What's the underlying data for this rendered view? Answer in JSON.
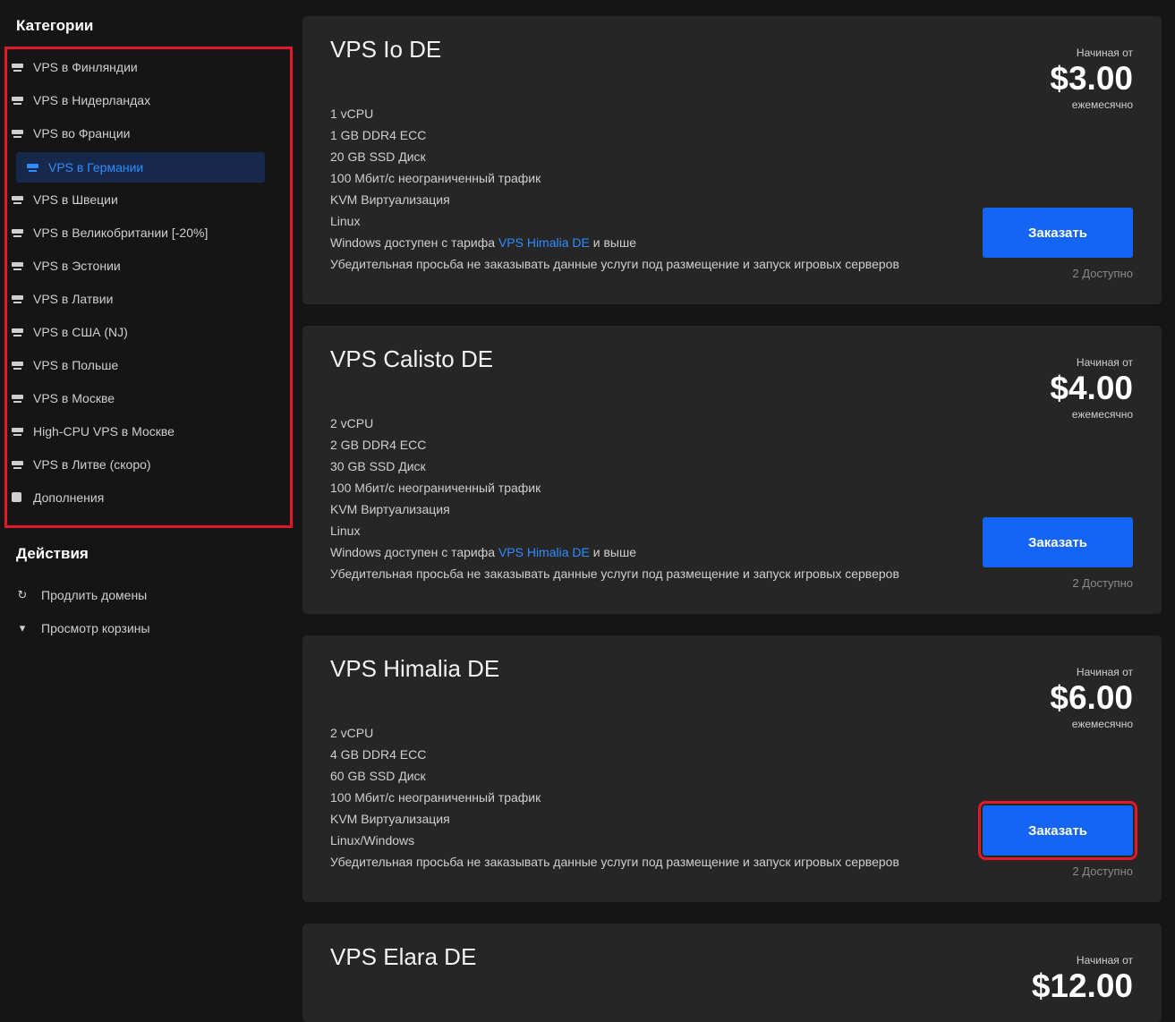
{
  "sidebar": {
    "categories_title": "Категории",
    "categories": [
      {
        "label": "VPS в Финляндии",
        "icon": "server-icon"
      },
      {
        "label": "VPS в Нидерландах",
        "icon": "server-icon"
      },
      {
        "label": "VPS во Франции",
        "icon": "server-icon"
      },
      {
        "label": "VPS в Германии",
        "icon": "server-icon",
        "active": true
      },
      {
        "label": "VPS в Швеции",
        "icon": "server-icon"
      },
      {
        "label": "VPS в Великобритании [-20%]",
        "icon": "server-icon"
      },
      {
        "label": "VPS в Эстонии",
        "icon": "server-icon"
      },
      {
        "label": "VPS в Латвии",
        "icon": "server-icon"
      },
      {
        "label": "VPS в США (NJ)",
        "icon": "server-icon"
      },
      {
        "label": "VPS в Польше",
        "icon": "server-icon"
      },
      {
        "label": "VPS в Москве",
        "icon": "server-icon"
      },
      {
        "label": "High-CPU VPS в Москве",
        "icon": "server-icon"
      },
      {
        "label": "VPS в Литве (скоро)",
        "icon": "server-icon"
      },
      {
        "label": "Дополнения",
        "icon": "box-icon"
      }
    ],
    "actions_title": "Действия",
    "actions": [
      {
        "label": "Продлить домены",
        "icon": "renew-icon"
      },
      {
        "label": "Просмотр корзины",
        "icon": "cart-icon"
      }
    ]
  },
  "products": [
    {
      "name": "VPS Io DE",
      "price_from": "Начиная от",
      "price": "$3.00",
      "period": "ежемесячно",
      "order_label": "Заказать",
      "availability": "2 Доступно",
      "features": [
        "1 vCPU",
        "1 GB DDR4 ECC",
        "20 GB SSD Диск",
        "100 Мбит/с неограниченный трафик",
        "KVM Виртуализация",
        "Linux"
      ],
      "windows_prefix": "Windows доступен с тарифа",
      "windows_link": "VPS Himalia DE",
      "windows_suffix": "и выше",
      "note": "Убедительная просьба не заказывать данные услуги под размещение и запуск игровых серверов"
    },
    {
      "name": "VPS Calisto DE",
      "price_from": "Начиная от",
      "price": "$4.00",
      "period": "ежемесячно",
      "order_label": "Заказать",
      "availability": "2 Доступно",
      "features": [
        "2 vCPU",
        "2 GB DDR4 ECC",
        "30 GB SSD Диск",
        "100 Мбит/с неограниченный трафик",
        "KVM Виртуализация",
        "Linux"
      ],
      "windows_prefix": "Windows доступен с тарифа",
      "windows_link": "VPS Himalia DE",
      "windows_suffix": "и выше",
      "note": "Убедительная просьба не заказывать данные услуги под размещение и запуск игровых серверов"
    },
    {
      "name": "VPS Himalia DE",
      "price_from": "Начиная от",
      "price": "$6.00",
      "period": "ежемесячно",
      "order_label": "Заказать",
      "availability": "2 Доступно",
      "features": [
        "2 vCPU",
        "4 GB DDR4 ECC",
        "60 GB SSD Диск",
        "100 Мбит/с неограниченный трафик",
        "KVM Виртуализация",
        "Linux/Windows"
      ],
      "note": "Убедительная просьба не заказывать данные услуги под размещение и запуск игровых серверов"
    },
    {
      "name": "VPS Elara DE",
      "price_from": "Начиная от",
      "price": "$12.00"
    }
  ],
  "colors": {
    "accent": "#1464f6",
    "link": "#2e8cff",
    "highlight": "#e3192a",
    "active_bg": "#16294a"
  }
}
